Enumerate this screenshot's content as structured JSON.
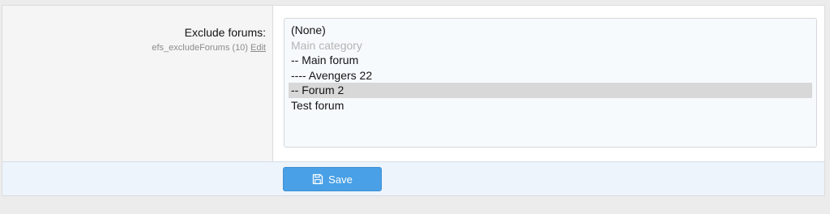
{
  "field": {
    "label": "Exclude forums:",
    "option_name": "efs_excludeForums (10)",
    "edit_label": "Edit"
  },
  "select": {
    "options": [
      {
        "label": "(None)",
        "disabled": false,
        "selected": false
      },
      {
        "label": "Main category",
        "disabled": true,
        "selected": false
      },
      {
        "label": "-- Main forum",
        "disabled": false,
        "selected": false
      },
      {
        "label": "---- Avengers 22",
        "disabled": false,
        "selected": false
      },
      {
        "label": "-- Forum 2",
        "disabled": false,
        "selected": true
      },
      {
        "label": "Test forum",
        "disabled": false,
        "selected": false
      }
    ]
  },
  "actions": {
    "save_label": "Save",
    "save_icon": "save-icon"
  },
  "colors": {
    "accent": "#49a0e6",
    "label_background": "#f5f5f5",
    "submit_row_background": "#edf4fb",
    "selected_option": "#d8d8d8"
  }
}
